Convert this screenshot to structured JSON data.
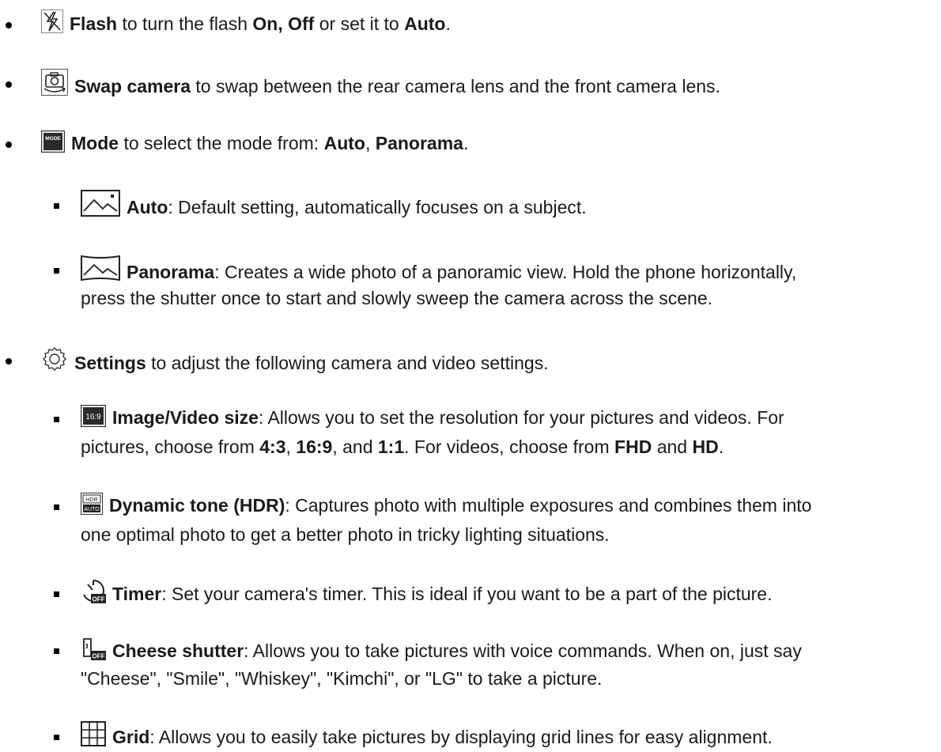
{
  "items": [
    {
      "icon": "flash-off-icon",
      "term": "Flash",
      "desc_a": " to turn the flash ",
      "opt1": "On, Off",
      "desc_b": " or set it to ",
      "opt2": "Auto",
      "desc_c": "."
    },
    {
      "icon": "swap-camera-icon",
      "term": "Swap camera",
      "desc": " to swap between the rear camera lens and the front camera lens."
    },
    {
      "icon": "mode-icon",
      "icon_text": "MODE",
      "term": "Mode",
      "desc_a": " to select the mode from: ",
      "opt1": "Auto",
      "sep": ", ",
      "opt2": "Panorama",
      "desc_b": "."
    },
    {
      "icon": "auto-mode-icon",
      "term": "Auto",
      "desc": ": Default setting, automatically focuses on a subject."
    },
    {
      "icon": "panorama-icon",
      "term": "Panorama",
      "desc_l1": ": Creates a wide photo of a panoramic view. Hold the phone horizontally,",
      "desc_l2": "press the shutter once to start and slowly sweep the camera across the scene."
    },
    {
      "icon": "settings-gear-icon",
      "term": "Settings",
      "desc": " to adjust the following camera and video settings."
    },
    {
      "icon": "image-size-icon",
      "icon_text": "16:9",
      "term": "Image/Video size",
      "desc_l1": ": Allows you to set the resolution for your pictures and videos. For",
      "l2_a": "pictures, choose from ",
      "r1": "4:3",
      "s1": ", ",
      "r2": "16:9",
      "s2": ", and ",
      "r3": "1:1",
      "l2_b": ". For videos, choose from ",
      "v1": "FHD",
      "s3": " and ",
      "v2": "HD",
      "l2_c": "."
    },
    {
      "icon": "hdr-icon",
      "icon_top": "HDR",
      "icon_bottom": "AUTO",
      "term": "Dynamic tone (HDR)",
      "desc_l1": ": Captures photo with multiple exposures and combines them into",
      "desc_l2": "one optimal photo to get a better photo in tricky lighting situations."
    },
    {
      "icon": "timer-icon",
      "icon_text": "OFF",
      "term": "Timer",
      "desc": ": Set your camera's timer. This is ideal if you want to be a part of the picture."
    },
    {
      "icon": "cheese-shutter-icon",
      "icon_text": "OFF",
      "term": "Cheese shutter",
      "desc_l1": ": Allows you to take pictures with voice commands. When on, just say",
      "desc_l2": "\"Cheese\", \"Smile\", \"Whiskey\", \"Kimchi\", or \"LG\" to take a picture."
    },
    {
      "icon": "grid-icon",
      "term": "Grid",
      "desc": ": Allows you to easily take pictures by displaying grid lines for easy alignment."
    }
  ]
}
